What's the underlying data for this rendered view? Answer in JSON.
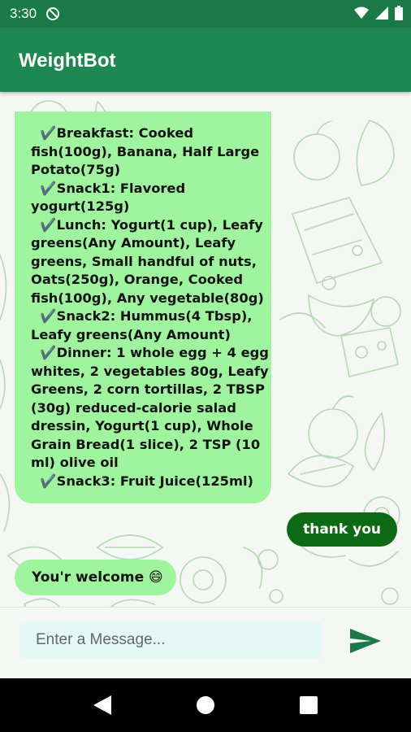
{
  "status_bar": {
    "time": "3:30"
  },
  "app_bar": {
    "title": "WeightBot"
  },
  "messages": {
    "bot_plan_lines": [
      "  ✔️Breakfast: Cooked",
      "fish(100g), Banana, Half Large",
      "Potato(75g)",
      "  ✔️Snack1: Flavored",
      "yogurt(125g)",
      "  ✔️Lunch: Yogurt(1 cup), Leafy",
      "greens(Any Amount), Leafy",
      "greens, Small handful of nuts,",
      "Oats(250g), Orange, Cooked",
      "fish(100g), Any vegetable(80g)",
      "  ✔️Snack2: Hummus(4 Tbsp),",
      "Leafy greens(Any Amount)",
      "  ✔️Dinner: 1 whole egg + 4 egg",
      "whites, 2 vegetables 80g, Leafy",
      "Greens, 2 corn tortillas, 2 TBSP",
      "(30g) reduced-calorie salad",
      "dressin, Yogurt(1 cup), Whole",
      "Grain Bread(1 slice), 2 TSP (10",
      "ml) olive oil",
      "  ✔️Snack3: Fruit Juice(125ml)"
    ],
    "user_reply": "thank you",
    "bot_reply": "You'r welcome 😄"
  },
  "input": {
    "placeholder": "Enter a Message...",
    "value": ""
  },
  "colors": {
    "status_bar": "#1a7a47",
    "app_bar": "#1f8750",
    "bot_bubble": "#9ef59e",
    "user_bubble": "#0d6a14",
    "send_icon": "#1a7a47",
    "input_bg": "#e4f8f6"
  },
  "icons": {
    "status": [
      "app-notification-icon",
      "wifi-icon",
      "cell-signal-icon",
      "battery-icon"
    ],
    "send": "send-icon",
    "nav": [
      "back-icon",
      "home-icon",
      "recents-icon"
    ]
  }
}
